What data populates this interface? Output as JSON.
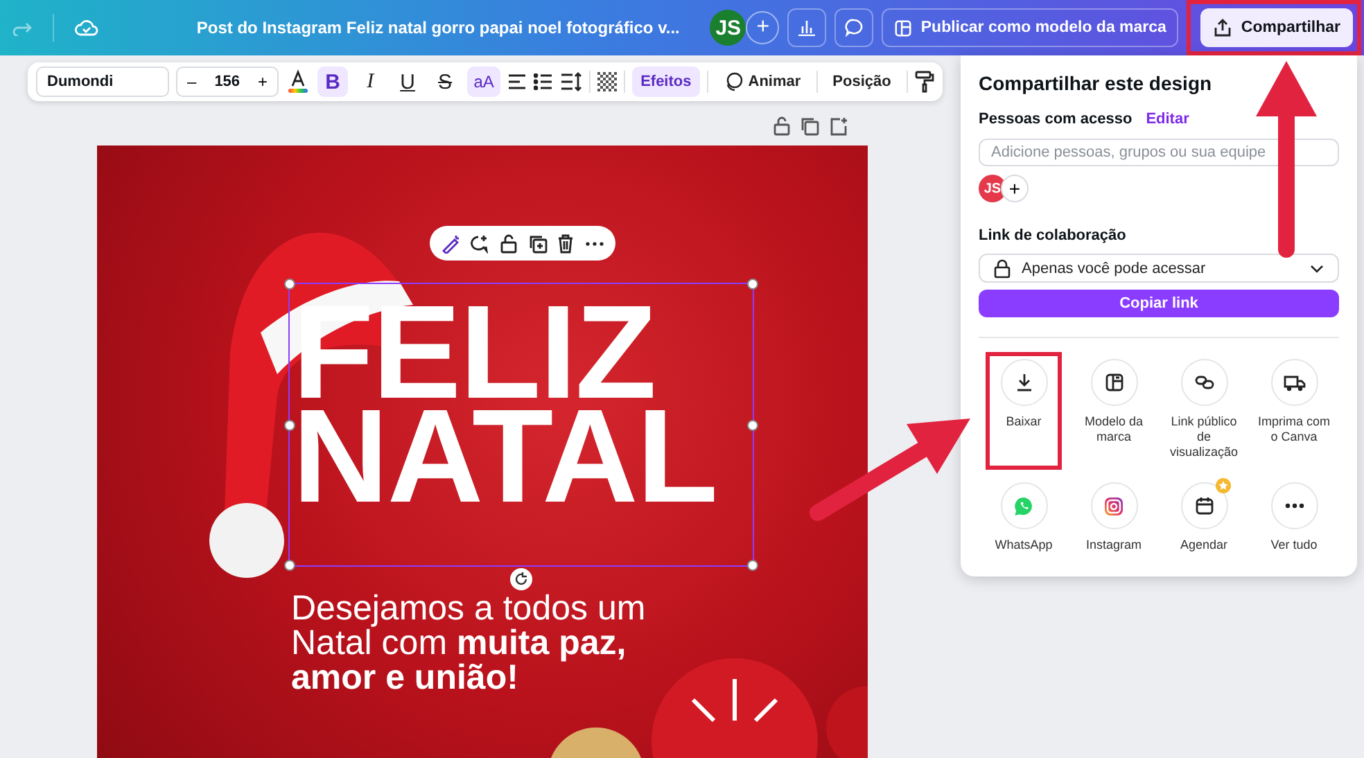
{
  "topbar": {
    "title": "Post do Instagram Feliz natal gorro papai noel fotográfico v...",
    "avatar": "JS",
    "add": "+",
    "publish_button": "Publicar como modelo da marca",
    "share_button": {
      "label": "Compartilhar",
      "highlighted": true
    }
  },
  "toolbar": {
    "font": "Dumondi",
    "minus": "–",
    "font_size": "156",
    "plus": "+",
    "format_buttons": [
      {
        "kind": "bold",
        "label": "B",
        "selected": true
      },
      {
        "kind": "italic",
        "label": "I",
        "selected": false
      },
      {
        "kind": "underline",
        "label": "U",
        "selected": false
      },
      {
        "kind": "strike",
        "label": "S",
        "selected": false
      },
      {
        "kind": "case",
        "label": "aA",
        "selected": true
      }
    ],
    "effects": {
      "label": "Efeitos",
      "selected": true
    },
    "animate": "Animar",
    "position": "Posição"
  },
  "design": {
    "heading": [
      "FELIZ",
      "NATAL"
    ],
    "message": [
      "Desejamos a todos um",
      "Natal com **muita paz,**",
      "**amor e união!**"
    ]
  },
  "share_panel": {
    "title": "Compartilhar este design",
    "people_label": "Pessoas com acesso",
    "edit_link": "Editar",
    "people_placeholder": "Adicione pessoas, grupos ou sua equipe",
    "avatar": "JS",
    "add": "+",
    "link_label": "Link de colaboração",
    "access": "Apenas você pode acessar",
    "copy_button": "Copiar link",
    "options": [
      {
        "kind": "download",
        "label": "Baixar",
        "highlighted": true,
        "badge": false
      },
      {
        "kind": "brand",
        "label": "Modelo da marca",
        "highlighted": false,
        "badge": false
      },
      {
        "kind": "link",
        "label": "Link público de visualização",
        "highlighted": false,
        "badge": false
      },
      {
        "kind": "print",
        "label": "Imprima com o Canva",
        "highlighted": false,
        "badge": false
      },
      {
        "kind": "whatsapp",
        "label": "WhatsApp",
        "highlighted": false,
        "badge": false
      },
      {
        "kind": "instagram",
        "label": "Instagram",
        "highlighted": false,
        "badge": false
      },
      {
        "kind": "schedule",
        "label": "Agendar",
        "highlighted": false,
        "badge": true
      },
      {
        "kind": "more",
        "label": "Ver tudo",
        "highlighted": false,
        "badge": false
      }
    ]
  }
}
